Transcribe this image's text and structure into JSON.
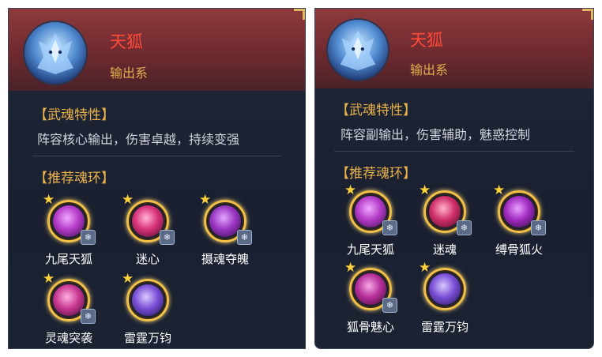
{
  "left_card": {
    "name": "天狐",
    "role": "输出系",
    "trait_title": "【武魂特性】",
    "trait_text": "阵容核心输出，伤害卓越，持续变强",
    "rings_title": "【推荐魂环】",
    "skills": [
      {
        "label": "九尾天狐",
        "color": "#b53cc8"
      },
      {
        "label": "迷心",
        "color": "#d8317a"
      },
      {
        "label": "摄魂夺魄",
        "color": "#9a35c2"
      },
      {
        "label": "灵魂突袭",
        "color": "#c83892"
      },
      {
        "label": "雷霆万钧",
        "color": "#7a4fd6"
      }
    ]
  },
  "right_card": {
    "name": "天狐",
    "role": "输出系",
    "trait_title": "【武魂特性】",
    "trait_text": "阵容副输出，伤害辅助，魅惑控制",
    "rings_title": "【推荐魂环】",
    "skills": [
      {
        "label": "九尾天狐",
        "color": "#b53cc8"
      },
      {
        "label": "迷魂",
        "color": "#d02f6a"
      },
      {
        "label": "缚骨狐火",
        "color": "#a02cc0"
      },
      {
        "label": "狐骨魅心",
        "color": "#b62f9a"
      },
      {
        "label": "雷霆万钧",
        "color": "#7a4fd6"
      }
    ]
  },
  "icons": {
    "star": "★",
    "badge": "❄"
  }
}
